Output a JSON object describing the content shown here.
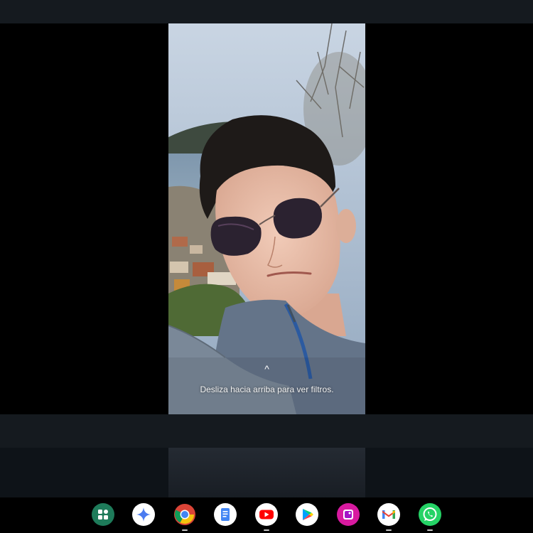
{
  "viewer": {
    "swipe_chevron": "^",
    "swipe_hint": "Desliza hacia arriba para ver filtros."
  },
  "shelf": {
    "apps": [
      {
        "name": "launcher",
        "icon": "launcher-icon",
        "running": false
      },
      {
        "name": "gemini",
        "icon": "gemini-icon",
        "running": false
      },
      {
        "name": "chrome",
        "icon": "chrome-icon",
        "running": true
      },
      {
        "name": "docs",
        "icon": "docs-icon",
        "running": false
      },
      {
        "name": "youtube",
        "icon": "youtube-icon",
        "running": true
      },
      {
        "name": "play-store",
        "icon": "play-store-icon",
        "running": false
      },
      {
        "name": "gallery",
        "icon": "gallery-icon",
        "running": false
      },
      {
        "name": "gmail",
        "icon": "gmail-icon",
        "running": true
      },
      {
        "name": "whatsapp",
        "icon": "whatsapp-icon",
        "running": true
      }
    ]
  },
  "colors": {
    "bar": "#151a1f",
    "background": "#000000",
    "youtube": "#ff0000",
    "whatsapp": "#25d366",
    "launcher": "#1e7b5a"
  }
}
